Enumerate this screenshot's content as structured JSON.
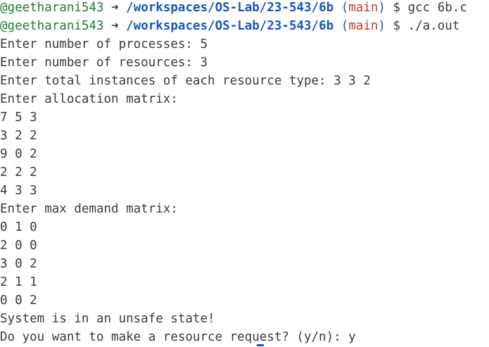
{
  "terminal": {
    "prompts": [
      {
        "user": "@geetharani543",
        "arrow": "➜",
        "path": "/workspaces/OS-Lab/23-543/6b",
        "branch_open": "(",
        "branch": "main",
        "branch_close": ")",
        "dollar": "$",
        "command": "gcc 6b.c"
      },
      {
        "user": "@geetharani543",
        "arrow": "➜",
        "path": "/workspaces/OS-Lab/23-543/6b",
        "branch_open": "(",
        "branch": "main",
        "branch_close": ")",
        "dollar": "$",
        "command": "./a.out"
      }
    ],
    "output": [
      "Enter number of processes: 5",
      "Enter number of resources: 3",
      "Enter total instances of each resource type: 3 3 2",
      "Enter allocation matrix:",
      "7 5 3",
      "3 2 2",
      "9 0 2",
      "2 2 2",
      "4 3 3",
      "Enter max demand matrix:",
      "0 1 0",
      "2 0 0",
      "3 0 2",
      "2 1 1",
      "0 0 2",
      "System is in an unsafe state!",
      "Do you want to make a resource request? (y/n): y"
    ]
  },
  "colors": {
    "user": "#1f7a3a",
    "path": "#1a56b8",
    "branch": "#c23b2e",
    "text": "#3b3b3b",
    "background": "#ffffff"
  }
}
